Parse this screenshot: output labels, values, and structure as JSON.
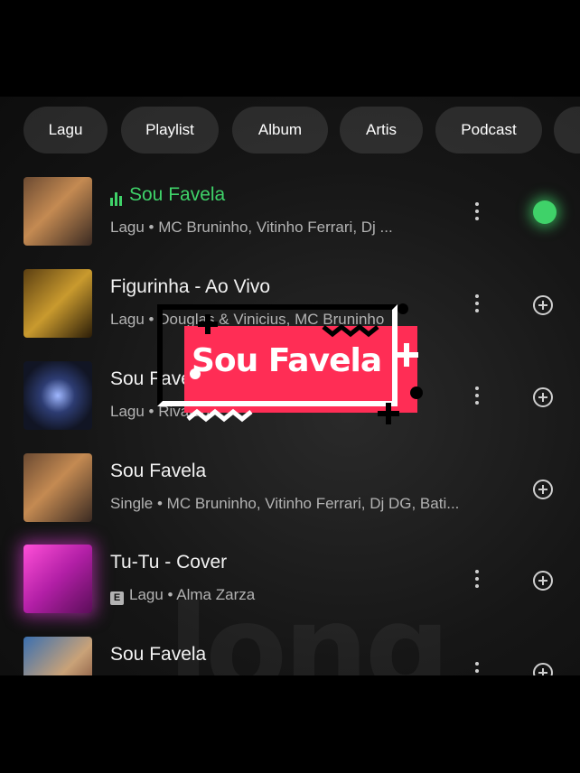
{
  "filters": [
    "Lagu",
    "Playlist",
    "Album",
    "Artis",
    "Podcast"
  ],
  "songs": [
    {
      "title": "Sou Favela",
      "subtitle": "Lagu • MC Bruninho, Vitinho Ferrari, Dj ...",
      "playing": true,
      "explicit": false,
      "saved": true
    },
    {
      "title": "Figurinha - Ao Vivo",
      "subtitle": "Lagu • Douglas & Vinicius, MC Bruninho",
      "playing": false,
      "explicit": false,
      "saved": false
    },
    {
      "title": "Sou Favela",
      "subtitle": "Lagu • Rivaldo",
      "playing": false,
      "explicit": false,
      "saved": false
    },
    {
      "title": "Sou Favela",
      "subtitle": "Single • MC Bruninho, Vitinho Ferrari, Dj DG, Bati...",
      "playing": false,
      "explicit": false,
      "saved": false
    },
    {
      "title": "Tu-Tu - Cover",
      "subtitle": "Lagu • Alma Zarza",
      "playing": false,
      "explicit": true,
      "saved": false
    },
    {
      "title": "Sou Favela",
      "subtitle": "",
      "playing": false,
      "explicit": false,
      "saved": false
    }
  ],
  "explicit_badge": "E",
  "sticker": {
    "text": "Sou Favela"
  },
  "watermark": "long",
  "colors": {
    "accent": "#3fd269",
    "sticker": "#ff2d55"
  }
}
